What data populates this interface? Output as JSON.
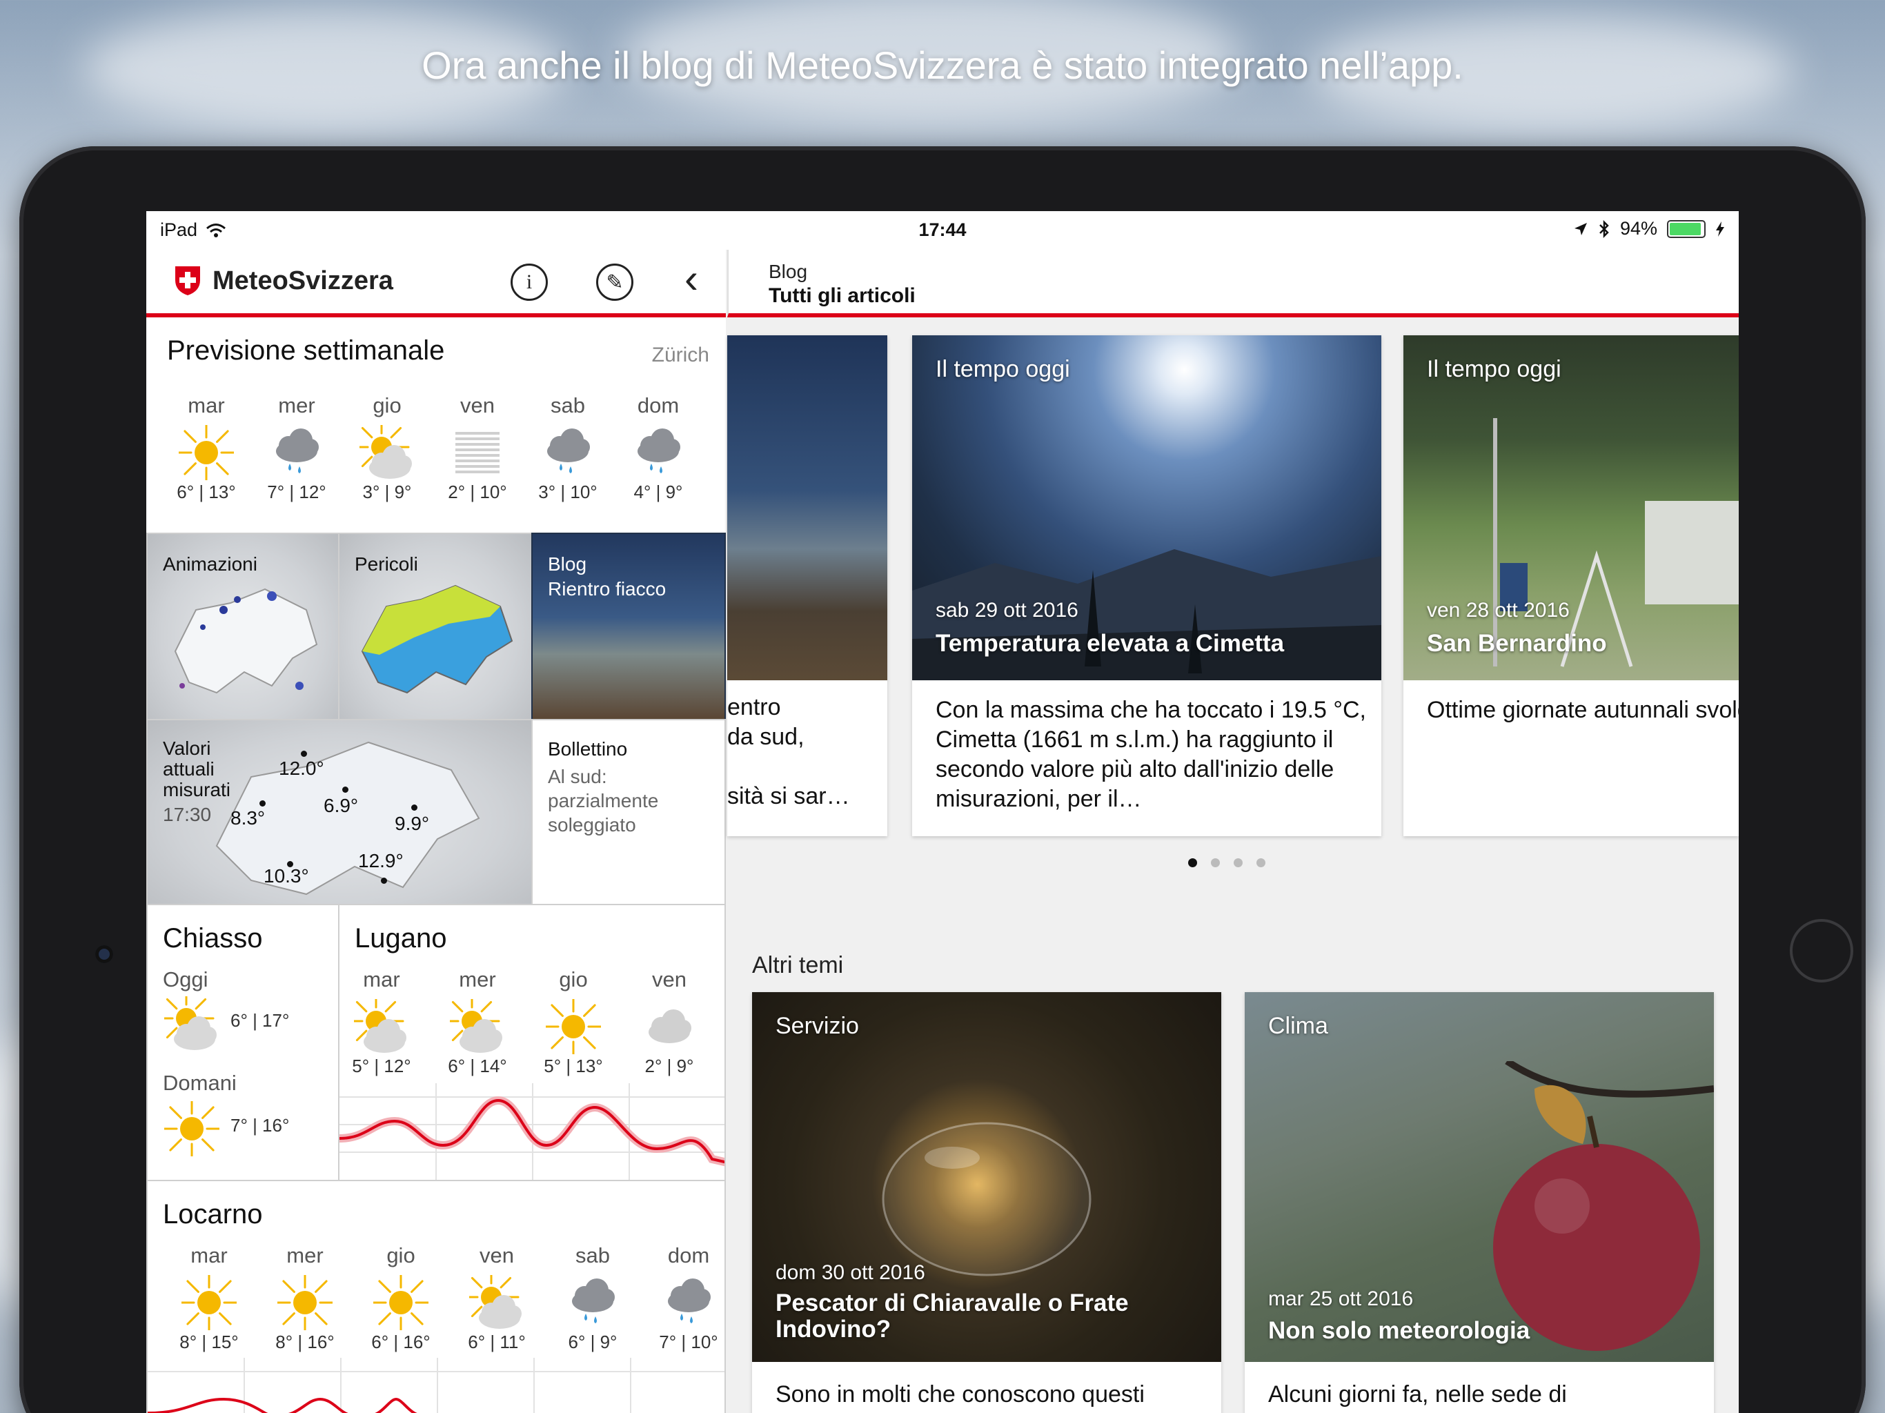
{
  "banner": "Ora anche il blog di MeteoSvizzera è stato integrato nell’app.",
  "status": {
    "device": "iPad",
    "time": "17:44",
    "battery": "94%"
  },
  "brand": {
    "name": "MeteoSvizzera"
  },
  "nav": {
    "info_label": "i",
    "edit_label": "✎",
    "back_label": "‹"
  },
  "right_nav": {
    "section": "Blog",
    "title": "Tutti gli articoli"
  },
  "weekly": {
    "title": "Previsione settimanale",
    "location": "Zürich",
    "days": [
      {
        "day": "mar",
        "icon": "sun-icon",
        "temps": "6° | 13°"
      },
      {
        "day": "mer",
        "icon": "cloud-rain-icon",
        "temps": "7° | 12°"
      },
      {
        "day": "gio",
        "icon": "sun-cloud-icon",
        "temps": "3° | 9°"
      },
      {
        "day": "ven",
        "icon": "fog-icon",
        "temps": "2° | 10°"
      },
      {
        "day": "sab",
        "icon": "cloud-rain-icon",
        "temps": "3° | 10°"
      },
      {
        "day": "dom",
        "icon": "cloud-rain-icon",
        "temps": "4° | 9°"
      }
    ]
  },
  "tiles": {
    "animazioni": "Animazioni",
    "pericoli": "Pericoli",
    "blog_section": "Blog",
    "blog_title": "Rientro fiacco",
    "valori_title": "Valori attuali misurati",
    "valori_time": "17:30",
    "valori_values": [
      "12.0°",
      "8.3°",
      "6.9°",
      "9.9°",
      "12.9°",
      "10.3°"
    ],
    "bollettino_title": "Bollettino",
    "bollettino_text": "Al sud: parzialmente soleggiato"
  },
  "chiasso": {
    "title": "Chiasso",
    "today_label": "Oggi",
    "today_temps": "6° | 17°",
    "tomorrow_label": "Domani",
    "tomorrow_temps": "7° | 16°"
  },
  "lugano": {
    "title": "Lugano",
    "days": [
      {
        "day": "mar",
        "icon": "sun-cloud-icon",
        "temps": "5° | 12°"
      },
      {
        "day": "mer",
        "icon": "sun-cloud-icon",
        "temps": "6° | 14°"
      },
      {
        "day": "gio",
        "icon": "sun-icon",
        "temps": "5° | 13°"
      },
      {
        "day": "ven",
        "icon": "cloud-icon",
        "temps": "2° | 9°"
      }
    ]
  },
  "locarno": {
    "title": "Locarno",
    "days": [
      {
        "day": "mar",
        "icon": "sun-icon",
        "temps": "8° | 15°"
      },
      {
        "day": "mer",
        "icon": "sun-icon",
        "temps": "8° | 16°"
      },
      {
        "day": "gio",
        "icon": "sun-icon",
        "temps": "6° | 16°"
      },
      {
        "day": "ven",
        "icon": "sun-cloud-icon",
        "temps": "6° | 11°"
      },
      {
        "day": "sab",
        "icon": "cloud-rain-icon",
        "temps": "6° | 9°"
      },
      {
        "day": "dom",
        "icon": "cloud-rain-icon",
        "temps": "7° | 10°"
      }
    ]
  },
  "articles": [
    {
      "body": "entro\nda sud,\n\nsità si sar…"
    },
    {
      "category": "Il tempo oggi",
      "date": "sab 29 ott 2016",
      "title": "Temperatura elevata a Cimetta",
      "body": "Con la massima che ha toccato i 19.5 °C, Cimetta (1661 m s.l.m.) ha raggiunto il secondo valore più alto dall'inizio delle misurazioni, per il…"
    },
    {
      "category": "Il tempo oggi",
      "date": "ven 28 ott 2016",
      "title": "San Bernardino",
      "body": "Ottime giornate autunnali svolgere la manutenzione alle stazioni di misura della SwissMetNet, ecco qualche"
    }
  ],
  "altri": {
    "title": "Altri temi",
    "items": [
      {
        "category": "Servizio",
        "date": "dom 30 ott 2016",
        "title": "Pescator di Chiaravalle o Frate Indovino?",
        "body": "Sono in molti che conoscono questi"
      },
      {
        "category": "Clima",
        "date": "mar 25 ott 2016",
        "title": "Non solo meteorologia",
        "body": "Alcuni giorni fa, nelle sede di"
      }
    ]
  },
  "colors": {
    "accent": "#dc0018",
    "sun": "#f5b800",
    "rain": "#3a9ad9"
  }
}
